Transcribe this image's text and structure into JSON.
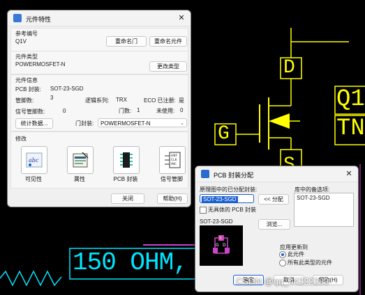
{
  "cad": {
    "pin_d": "D",
    "pin_g": "G",
    "pin_s": "S",
    "ref_fragment": "Q1",
    "type_fragment": "TN",
    "resistor_text": "150 OHM,",
    "watermark": "CSDN @qq_44222283"
  },
  "props": {
    "title": "元件特性",
    "close": "✕",
    "ref_label": "参考编号",
    "ref_value": "Q1V",
    "rename_gate": "重命名门",
    "rename_part": "重命名元件",
    "type_label": "元件类型",
    "type_value": "POWERMOSFET-N",
    "change_type": "更改类型",
    "info_label": "元件信息",
    "pcb_decal_label": "PCB 封装:",
    "pcb_decal_value": "SOT-23-SGD",
    "pins_label": "管脚数:",
    "pins_value": "3",
    "logic_family_label": "逻辑系列:",
    "logic_family_value": "TRX",
    "eco_label": "ECO 已注册:",
    "eco_value": "是",
    "signal_pins_label": "信号管脚数:",
    "signal_pins_value": "0",
    "gates_label": "门数:",
    "gates_value": "1",
    "unused_label": "未使用:",
    "unused_value": "0",
    "stats_button": "统计数据...",
    "gate_decal_label": "门封装:",
    "gate_decal_value": "POWERMOSFET-N",
    "modify_label": "修改",
    "tool_visibility": "可见性",
    "tool_attributes": "属性",
    "tool_pcb_decal": "PCB 封装",
    "tool_signal_pins": "信号管脚",
    "close_button": "关闭",
    "help_button": "帮助(H)",
    "signal_icon_lines": [
      "HBF",
      "CLK",
      "INC"
    ]
  },
  "decal": {
    "title": "PCB 封装分配",
    "close": "✕",
    "assigned_label": "原理图中的已分配封装:",
    "assigned_value": "SOT-23-SGD",
    "assign_button": "<< 分配",
    "library_label": "库中的备选项:",
    "library_items": [
      "SOT-23-SGD"
    ],
    "unique_label": "无具体的 PCB 封装",
    "preview_label": "SOT-23-SGD",
    "browse_button": "浏览...",
    "apply_label": "应用更新到",
    "this_part": "此元件",
    "all_parts": "所有此类型的元件",
    "ok_button": "确定",
    "cancel_button": "取消",
    "help_button": "帮助(H)"
  },
  "colors": {
    "cad_yellow": "#ffff00",
    "cad_cyan": "#00e5ff",
    "cad_magenta": "#cc44cc",
    "accent_blue": "#1a5fd0"
  }
}
